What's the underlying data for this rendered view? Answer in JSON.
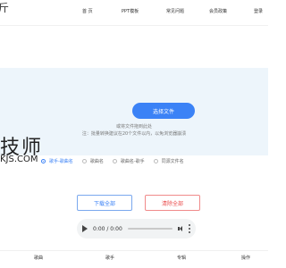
{
  "header": {
    "logo_fragment": "斤",
    "nav": [
      "首 页",
      "PPT模板",
      "常见问题",
      "会员政策",
      "登录"
    ]
  },
  "upload": {
    "choose_button": "选择文件",
    "drop_hint": "或将文件拖到此处",
    "note": "注：批量转换建议在20个文件以内，以免浏览器崩溃"
  },
  "watermark": {
    "cn": "技师",
    "en": "KJS.COM"
  },
  "radios": {
    "selected_index": 0,
    "options": [
      "歌手-歌曲名",
      "歌曲名",
      "歌曲名-歌手",
      "同源文件名"
    ]
  },
  "actions": {
    "download_all": "下载全部",
    "clear_all": "清除全部"
  },
  "player": {
    "time": "0:00 / 0:00"
  },
  "table": {
    "headers": [
      "歌曲",
      "歌手",
      "专辑",
      "操作"
    ]
  },
  "colors": {
    "accent": "#3b82f6",
    "danger": "#ea4b4b",
    "upload_bg": "#edf5fb"
  }
}
